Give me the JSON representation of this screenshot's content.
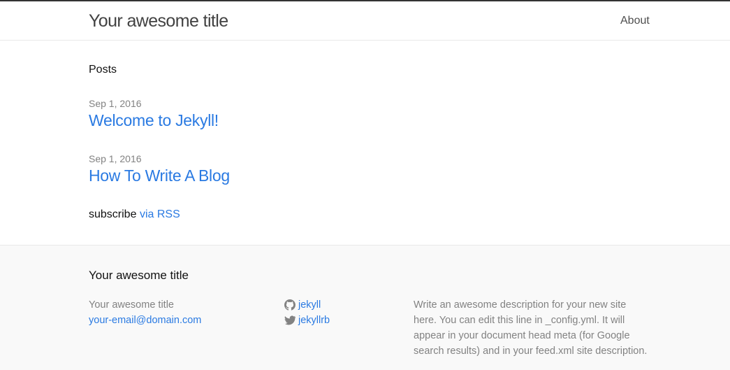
{
  "header": {
    "site_title": "Your awesome title",
    "nav": [
      {
        "label": "About"
      }
    ]
  },
  "main": {
    "heading": "Posts",
    "posts": [
      {
        "date": "Sep 1, 2016",
        "title": "Welcome to Jekyll!"
      },
      {
        "date": "Sep 1, 2016",
        "title": "How To Write A Blog"
      }
    ],
    "rss_prefix": "subscribe",
    "rss_link": "via RSS"
  },
  "footer": {
    "heading": "Your awesome title",
    "name": "Your awesome title",
    "email": "your-email@domain.com",
    "github": {
      "icon": "github-icon",
      "username": "jekyll"
    },
    "twitter": {
      "icon": "twitter-icon",
      "username": "jekyllrb"
    },
    "description": "Write an awesome description for your new site here. You can edit this line in _config.yml. It will appear in your document head meta (for Google search results) and in your feed.xml site description."
  },
  "colors": {
    "link": "#2a7ae2",
    "meta_text": "#828282",
    "footer_bg": "#f9f9f9",
    "header_border_top": "#333333"
  }
}
